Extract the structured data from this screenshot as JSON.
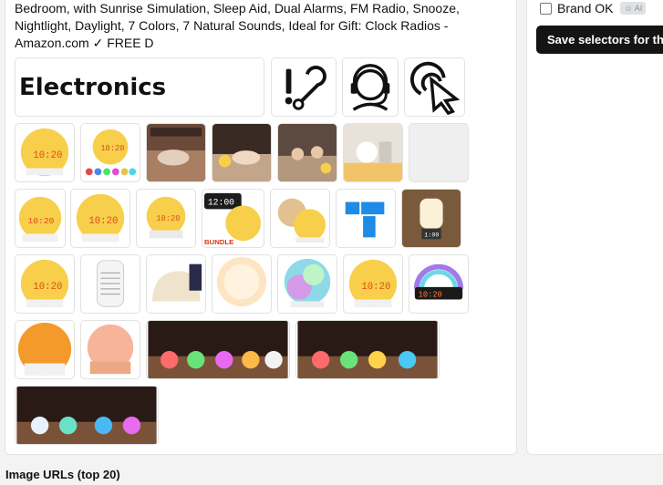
{
  "product": {
    "description": "Bedroom, with Sunrise Simulation, Sleep Aid, Dual Alarms, FM Radio, Snooze, Nightlight, Daylight, 7 Colors, 7 Natural Sounds, Ideal for Gift: Clock Radios - Amazon.com ✓ FREE D"
  },
  "gallery": {
    "category_banner": "Electronics",
    "bundle_label": "BUNDLE",
    "clock_readout": "10:20",
    "dark_clock_readout": "12:00",
    "bedside_time": "1:00"
  },
  "sidebar": {
    "brand_ok_label": "Brand OK",
    "ai_badge_label": "AI",
    "save_button_label": "Save selectors for this"
  },
  "footer": {
    "image_urls_title": "Image URLs (top 20)"
  },
  "colors": {
    "accent_dark": "#141414",
    "lamp_yellow": "#f7cf4a",
    "lamp_orange": "#f39a2a",
    "clock_digits": "#e24a1a"
  }
}
